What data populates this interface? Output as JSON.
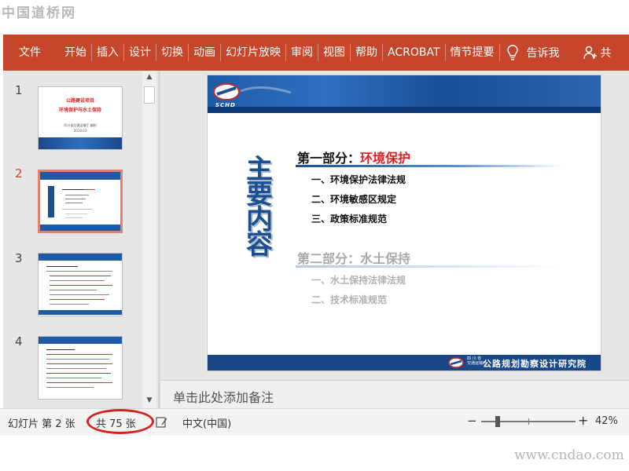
{
  "watermarks": {
    "top": "中国道桥网",
    "bottom": "www.cndao.com"
  },
  "ribbon": {
    "file": "文件",
    "tabs": [
      "开始",
      "插入",
      "设计",
      "切换",
      "动画",
      "幻灯片放映",
      "审阅",
      "视图",
      "帮助",
      "ACROBAT",
      "情节提要"
    ],
    "tell_me": "告诉我",
    "share": "共",
    "accent_color": "#c5462b"
  },
  "thumbnails": [
    {
      "number": "1",
      "title_line1": "公路建设项目",
      "title_line2": "环境保护与水土保持",
      "sub_line1": "四川省交通运输厅 编制",
      "sub_line2": "2018.03"
    },
    {
      "number": "2",
      "active": true
    },
    {
      "number": "3"
    },
    {
      "number": "4"
    }
  ],
  "slide": {
    "logo_text": "SCHD",
    "main_title": "主要内容",
    "part1_prefix": "第一部分：",
    "part1_highlight": "环境保护",
    "part1_items": [
      "一、环境保护法律法规",
      "二、环境敏感区规定",
      "三、政策标准规范"
    ],
    "part2_title": "第二部分：水土保持",
    "part2_items": [
      "一、水土保持法律法规",
      "二、技术标准规范"
    ],
    "footer_small_1": "四 川 省",
    "footer_small_2": "交通运输厅",
    "footer_text": "公路规划勘察设计研究院"
  },
  "notes_placeholder": "单击此处添加备注",
  "status": {
    "slide_info": "幻灯片 第 2 张",
    "total": "共 75 张",
    "language": "中文(中国)",
    "zoom_minus": "−",
    "zoom_plus": "+",
    "zoom_level": "42%"
  }
}
